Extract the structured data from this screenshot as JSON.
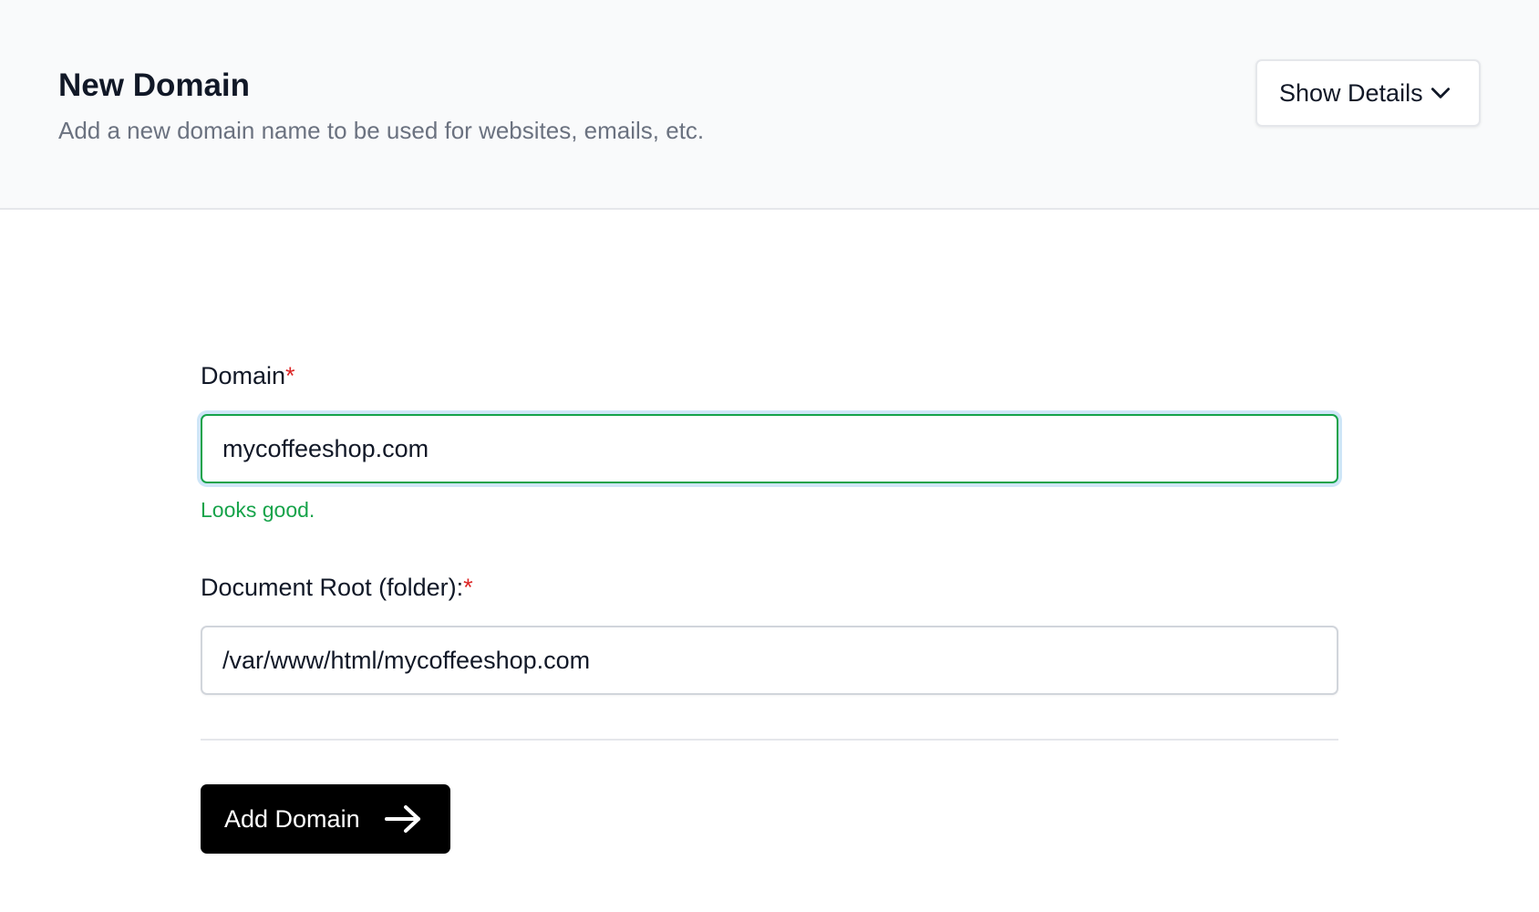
{
  "header": {
    "title": "New Domain",
    "subtitle": "Add a new domain name to be used for websites, emails, etc.",
    "details_button": {
      "label": "Show Details",
      "icon": "chevron-down-icon"
    }
  },
  "form": {
    "domain": {
      "label": "Domain",
      "required_mark": "*",
      "value": "mycoffeeshop.com",
      "validation_message": "Looks good."
    },
    "document_root": {
      "label": "Document Root (folder):",
      "required_mark": "*",
      "value": "/var/www/html/mycoffeeshop.com"
    },
    "submit": {
      "label": "Add Domain",
      "icon": "arrow-right-icon"
    }
  },
  "colors": {
    "header_bg": "#f9fafb",
    "valid_green": "#16a34a",
    "required_red": "#dc2626",
    "primary_button": "#000000",
    "subtitle_gray": "#6b7280"
  }
}
